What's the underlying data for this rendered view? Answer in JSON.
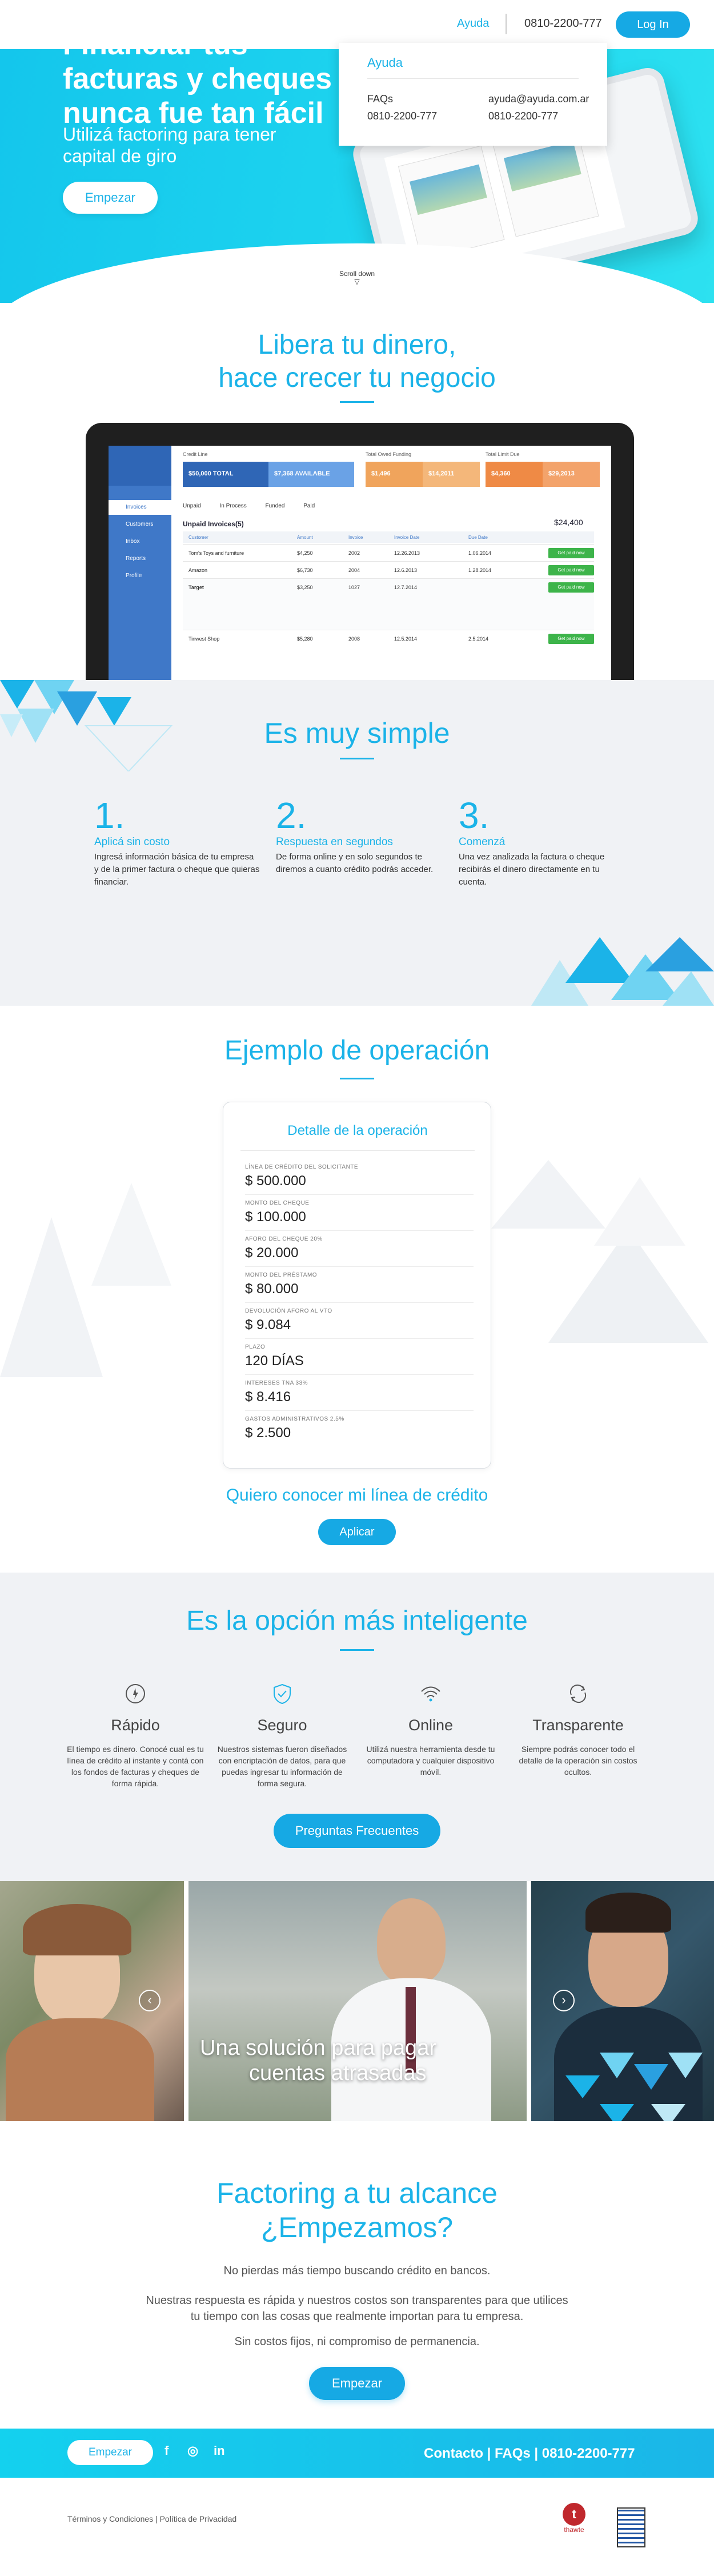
{
  "nav": {
    "help_label": "Ayuda",
    "phone": "0810-2200-777",
    "login_label": "Log In"
  },
  "help_dropdown": {
    "title": "Ayuda",
    "faq_label": "FAQs",
    "phone_left": "0810-2200-777",
    "email": "ayuda@ayuda.com.ar",
    "phone_right": "0810-2200-777"
  },
  "hero": {
    "title": "Financiar tus facturas y cheques nunca fue tan fácil",
    "subtitle": "Utilizá factoring para tener capital de giro",
    "cta_label": "Empezar",
    "scroll_label": "Scroll down"
  },
  "liberate": {
    "title_line1": "Libera tu dinero,",
    "title_line2": "hace crecer tu negocio"
  },
  "dashboard": {
    "sidebar": [
      "Invoices",
      "Customers",
      "Inbox",
      "Reports",
      "Profile"
    ],
    "kpis": [
      {
        "label": "Credit Line",
        "value": "$50,000 TOTAL",
        "color": "#2f66b6"
      },
      {
        "label": "",
        "value": "$7,368 AVAILABLE",
        "color": "#6aa2e6"
      },
      {
        "label": "Total Owed Funding",
        "value": "$1,496",
        "color": "#f0a45c"
      },
      {
        "label": "",
        "value": "$14,2011",
        "color": "#f0a45c"
      },
      {
        "label": "Total Limit Due",
        "value": "$4,360",
        "color": "#ef8a45"
      },
      {
        "label": "",
        "value": "$29,2013",
        "color": "#ef8a45"
      }
    ],
    "tabs": [
      "Unpaid",
      "In Process",
      "Funded",
      "Paid"
    ],
    "section_title": "Unpaid Invoices(5)",
    "total": "$24,400",
    "columns": [
      "Customer",
      "Amount",
      "Invoice",
      "Invoice Date",
      "Due Date"
    ],
    "rows": [
      {
        "customer": "Tom's Toys and furniture",
        "amount": "$4,250",
        "invoice": "2002",
        "date": "12.26.2013",
        "due": "1.06.2014"
      },
      {
        "customer": "Amazon",
        "amount": "$6,730",
        "invoice": "2004",
        "date": "12.6.2013",
        "due": "1.28.2014"
      },
      {
        "customer": "Target",
        "amount": "$3,250",
        "invoice": "1027",
        "date": "12.7.2014",
        "due": ""
      },
      {
        "customer": "Tinwest Shop",
        "amount": "$5,280",
        "invoice": "2008",
        "date": "12.5.2014",
        "due": "2.5.2014"
      }
    ],
    "get_paid_label": "Get paid now"
  },
  "simple": {
    "title": "Es muy simple",
    "steps": [
      {
        "num": "1.",
        "title": "Aplicá sin costo",
        "text": "Ingresá información básica de tu empresa y de la primer factura o cheque que quieras financiar."
      },
      {
        "num": "2.",
        "title": "Respuesta en segundos",
        "text": "De forma online y en solo segundos te diremos a cuanto crédito podrás acceder."
      },
      {
        "num": "3.",
        "title": "Comenzá",
        "text": "Una vez analizada la factura o cheque recibirás el dinero directamente en tu cuenta."
      }
    ]
  },
  "example": {
    "title": "Ejemplo de operación",
    "card_title": "Detalle de la operación",
    "items": [
      {
        "label": "LÍNEA DE CRÉDITO DEL SOLICITANTE",
        "value": "$ 500.000"
      },
      {
        "label": "MONTO DEL CHEQUE",
        "value": "$ 100.000"
      },
      {
        "label": "AFORO DEL CHEQUE 20%",
        "value": "$ 20.000"
      },
      {
        "label": "MONTO DEL PRÉSTAMO",
        "value": "$ 80.000"
      },
      {
        "label": "DEVOLUCIÓN AFORO AL VTO",
        "value": "$ 9.084"
      },
      {
        "label": "PLAZO",
        "value": "120 DÍAS"
      },
      {
        "label": "INTERESES TNA 33%",
        "value": "$ 8.416"
      },
      {
        "label": "GASTOS ADMINISTRATIVOS 2.5%",
        "value": "$ 2.500"
      }
    ],
    "question": "Quiero conocer mi línea de crédito",
    "apply_label": "Aplicar"
  },
  "smart": {
    "title": "Es la opción más inteligente",
    "features": [
      {
        "icon": "speed-icon",
        "title": "Rápido",
        "text": "El tiempo es dinero. Conocé cual es tu línea de crédito al instante y contá con los fondos de facturas y cheques de forma rápida."
      },
      {
        "icon": "shield-icon",
        "title": "Seguro",
        "text": "Nuestros sistemas fueron diseñados con encriptación de datos, para que puedas ingresar tu información de forma segura."
      },
      {
        "icon": "wifi-icon",
        "title": "Online",
        "text": "Utilizá nuestra herramienta desde tu computadora y cualquier dispositivo móvil."
      },
      {
        "icon": "refresh-icon",
        "title": "Transparente",
        "text": "Siempre podrás conocer todo el detalle de la operación sin costos ocultos."
      }
    ],
    "faq_label": "Preguntas Frecuentes"
  },
  "carousel": {
    "caption_line1": "Una solución para pagar",
    "caption_line2": "cuentas atrasadas",
    "prev_label": "‹",
    "next_label": "›"
  },
  "cta": {
    "title_line1": "Factoring a tu alcance",
    "title_line2": "¿Empezamos?",
    "p1": "No pierdas más tiempo buscando crédito en bancos.",
    "p2": "Nuestras respuesta es rápida y nuestros costos son transparentes para que utilices tu tiempo con las cosas que realmente importan para tu empresa.",
    "p3": "Sin costos fijos, ni compromiso de permanencia.",
    "button_label": "Empezar"
  },
  "footer": {
    "button_label": "Empezar",
    "social": [
      "f",
      "◎",
      "in"
    ],
    "links": "Contacto | FAQs | 0810-2200-777",
    "legal": "Términos y Condiciones | Política de Privacidad",
    "thawte_label": "thawte"
  }
}
